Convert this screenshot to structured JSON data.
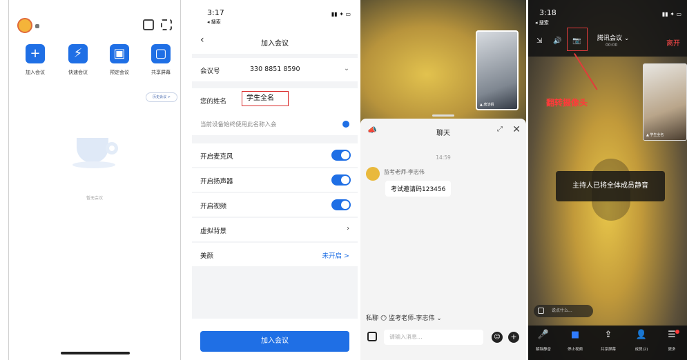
{
  "panel1": {
    "tiles": [
      {
        "label": "加入会议",
        "glyph": "+"
      },
      {
        "label": "快速会议",
        "glyph": "⚡"
      },
      {
        "label": "预定会议",
        "glyph": "▣"
      },
      {
        "label": "共享屏幕",
        "glyph": "▢"
      }
    ],
    "history_label": "历史会议 >",
    "empty_label": "暂无会议"
  },
  "panel2": {
    "status_time": "3:17",
    "status_back": "◂ 搜索",
    "status_signal": "▮▮ ✦ ▭",
    "nav_title": "加入会议",
    "meeting_id_label": "会议号",
    "meeting_id_value": "330 8851 8590",
    "name_label": "您的姓名",
    "name_value": "学生全名",
    "hint": "当前设备始终使用此名称入会",
    "mic_label": "开启麦克风",
    "speaker_label": "开启扬声器",
    "video_label": "开启视频",
    "bg_label": "虚拟背景",
    "beauty_label": "美颜",
    "beauty_value": "未开启 >",
    "join_button": "加入会议"
  },
  "panel3": {
    "pip_name": "▲ 唐洁娟",
    "chat_title": "聊天",
    "chat_time": "14:59",
    "sender": "监考老师-李志伟",
    "message": "考试邀请码123456",
    "private_label": "私聊 😶 监考老师-李志伟 ⌄",
    "input_placeholder": "请输入消息..."
  },
  "panel4": {
    "status_time": "3:18",
    "status_back": "◂ 搜索",
    "status_signal": "▮▮ ✦ ▭",
    "meeting_title": "腾讯会议 ⌄",
    "meeting_timer": "00:00",
    "leave_label": "离开",
    "annotation": "翻转摄像头",
    "toast": "主持人已将全体成员静音",
    "pip_name": "▲ 学生全名",
    "bubble_placeholder": "说点什么...",
    "bottom": [
      {
        "label": "解除静音",
        "glyph": "🎤"
      },
      {
        "label": "停止视频",
        "glyph": "■"
      },
      {
        "label": "共享屏幕",
        "glyph": "⇪"
      },
      {
        "label": "成员(2)",
        "glyph": "👤"
      },
      {
        "label": "更多",
        "glyph": "☰"
      }
    ]
  },
  "colors": {
    "accent": "#1f6fe5",
    "leave": "#ff4a4a",
    "annotation": "#e23b3b"
  }
}
